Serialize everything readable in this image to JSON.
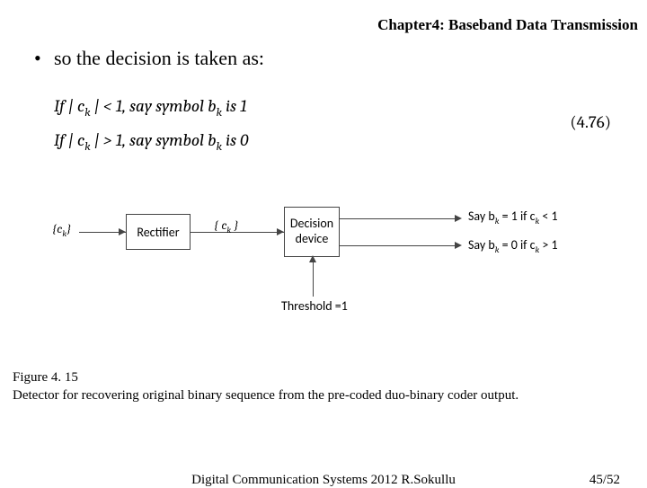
{
  "header": {
    "chapter": "Chapter4: Baseband Data Transmission"
  },
  "bullet": {
    "text": "so the decision is taken as:"
  },
  "equations": {
    "line1_prefix": "If | c",
    "line1_sub": "k",
    "line1_mid": " | < 1,    say symbol b",
    "line1_sub2": "k",
    "line1_suffix": " is 1",
    "line2_prefix": "If | c",
    "line2_sub": "k",
    "line2_mid": " | > 1,    say symbol b",
    "line2_sub2": "k",
    "line2_suffix": " is 0",
    "number": "(4.76)"
  },
  "diagram": {
    "input_label_open": "{c",
    "input_label_sub": "k",
    "input_label_close": "}",
    "rectifier": "Rectifier",
    "mid_label_open": "{   c",
    "mid_label_sub": "k",
    "mid_label_close": "   }",
    "decision": "Decision\ndevice",
    "threshold": "Threshold =1",
    "out1_pre": "Say b",
    "out1_sub": "k",
    "out1_mid": " = 1 if    c",
    "out1_sub2": "k",
    "out1_post": "    <  1",
    "out2_pre": "Say b",
    "out2_sub": "k",
    "out2_mid": " = 0 if    c",
    "out2_sub2": "k",
    "out2_post": "    >  1"
  },
  "figure": {
    "number": "Figure 4. 15",
    "caption": "Detector for recovering original binary sequence from the pre-coded duo-binary coder output."
  },
  "footer": {
    "center": "Digital Communication Systems 2012 R.Sokullu",
    "page": "45/52"
  }
}
